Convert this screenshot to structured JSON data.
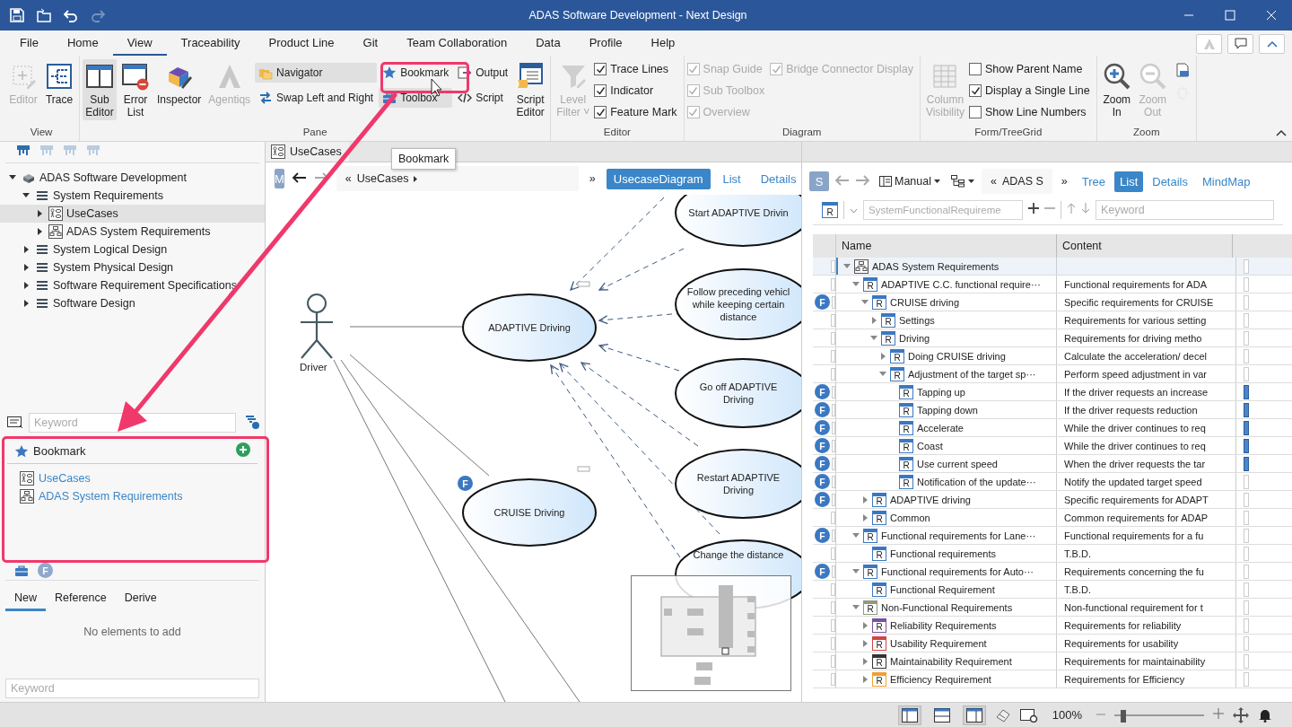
{
  "window": {
    "title": "ADAS Software Development - Next Design"
  },
  "quick_access": [
    {
      "disabled": false
    },
    {
      "disabled": false
    },
    {
      "disabled": false
    },
    {
      "disabled": true
    }
  ],
  "menu": [
    {
      "label": "File",
      "selected": false
    },
    {
      "label": "Home",
      "selected": false
    },
    {
      "label": "View",
      "selected": true
    },
    {
      "label": "Traceability",
      "selected": false
    },
    {
      "label": "Product Line",
      "selected": false
    },
    {
      "label": "Git",
      "selected": false
    },
    {
      "label": "Team Collaboration",
      "selected": false
    },
    {
      "label": "Data",
      "selected": false
    },
    {
      "label": "Profile",
      "selected": false
    },
    {
      "label": "Help",
      "selected": false
    }
  ],
  "ribbon": [
    {
      "label": "View",
      "columns": [
        [
          {
            "kind": "big",
            "label": "Editor",
            "disabled": true,
            "selected": false
          }
        ],
        [
          {
            "kind": "big",
            "label": "Trace",
            "disabled": false,
            "selected": false
          }
        ]
      ]
    },
    {
      "label": "Pane",
      "columns": [
        [
          {
            "kind": "big",
            "label": "Sub\nEditor",
            "disabled": false,
            "selected": true
          }
        ],
        [
          {
            "kind": "big",
            "label": "Error\nList",
            "disabled": false,
            "selected": false
          }
        ],
        [
          {
            "kind": "big",
            "label": "Inspector",
            "disabled": false,
            "selected": false
          }
        ],
        [
          {
            "kind": "big",
            "label": "Agentiqs",
            "disabled": true,
            "selected": false
          }
        ],
        [
          {
            "kind": "small",
            "label": "Navigator",
            "disabled": false,
            "selected": true
          },
          {
            "kind": "small",
            "label": "Swap Left and Right",
            "disabled": false,
            "selected": false
          }
        ],
        [
          {
            "kind": "small",
            "label": "Bookmark",
            "disabled": false,
            "selected": false
          },
          {
            "kind": "small",
            "label": "Toolbox",
            "disabled": false,
            "selected": true
          }
        ],
        [
          {
            "kind": "small",
            "label": "Output",
            "disabled": false,
            "selected": false
          },
          {
            "kind": "small",
            "label": "Script",
            "disabled": false,
            "selected": false
          }
        ],
        [
          {
            "kind": "big",
            "label": "Script\nEditor",
            "disabled": false,
            "selected": false
          }
        ]
      ]
    },
    {
      "label": "Editor",
      "columns": [
        [
          {
            "kind": "big",
            "label": "Level\nFilter ˅",
            "disabled": true,
            "selected": false
          }
        ],
        [
          {
            "kind": "check",
            "label": "Trace Lines",
            "checked": true,
            "disabled": false
          },
          {
            "kind": "check",
            "label": "Indicator",
            "checked": true,
            "disabled": false
          },
          {
            "kind": "check",
            "label": "Feature Mark",
            "checked": true,
            "disabled": false
          }
        ]
      ]
    },
    {
      "label": "Diagram",
      "columns": [
        [
          {
            "kind": "check",
            "label": "Snap Guide",
            "checked": true,
            "disabled": true
          },
          {
            "kind": "check",
            "label": "Sub Toolbox",
            "checked": true,
            "disabled": true
          },
          {
            "kind": "check",
            "label": "Overview",
            "checked": true,
            "disabled": true
          }
        ],
        [
          {
            "kind": "check",
            "label": "Bridge Connector Display",
            "checked": true,
            "disabled": true
          }
        ]
      ]
    },
    {
      "label": "Form/TreeGrid",
      "columns": [
        [
          {
            "kind": "big",
            "label": "Column\nVisibility",
            "disabled": true,
            "selected": false
          }
        ],
        [
          {
            "kind": "check",
            "label": "Show Parent Name",
            "checked": false,
            "disabled": false
          },
          {
            "kind": "check",
            "label": "Display a Single Line",
            "checked": true,
            "disabled": false
          },
          {
            "kind": "check",
            "label": "Show Line Numbers",
            "checked": false,
            "disabled": false
          }
        ]
      ]
    },
    {
      "label": "Zoom",
      "columns": [
        [
          {
            "kind": "big",
            "label": "Zoom\nIn",
            "disabled": false,
            "selected": false
          }
        ],
        [
          {
            "kind": "big",
            "label": "Zoom\nOut",
            "disabled": true,
            "selected": false
          }
        ],
        [
          {
            "kind": "icon",
            "disabled": false,
            "selected": false
          },
          {
            "kind": "icon",
            "disabled": true,
            "selected": false
          }
        ]
      ]
    }
  ],
  "tooltip": {
    "text": "Bookmark"
  },
  "model_panel": {
    "toolbar": [
      {
        "disabled": false
      },
      {
        "disabled": true
      },
      {
        "disabled": true
      },
      {
        "disabled": true
      }
    ],
    "tree": [
      {
        "kind": "project",
        "label": "ADAS Software Development",
        "expanded": true,
        "selected": false,
        "children": [
          {
            "kind": "folder",
            "label": "System Requirements",
            "expanded": true,
            "selected": false,
            "children": [
              {
                "kind": "usecase",
                "label": "UseCases",
                "expanded": false,
                "selected": true
              },
              {
                "kind": "package",
                "label": "ADAS System Requirements",
                "expanded": false,
                "selected": false
              }
            ]
          },
          {
            "kind": "folder",
            "label": "System Logical Design",
            "expanded": false,
            "selected": false
          },
          {
            "kind": "folder",
            "label": "System Physical Design",
            "expanded": false,
            "selected": false
          },
          {
            "kind": "folder",
            "label": "Software Requirement Specifications",
            "expanded": false,
            "selected": false
          },
          {
            "kind": "folder",
            "label": "Software Design",
            "expanded": false,
            "selected": false
          }
        ]
      }
    ],
    "search": {
      "placeholder": "Keyword"
    }
  },
  "bookmark_panel": {
    "title": "Bookmark",
    "items": [
      {
        "kind": "usecase",
        "label": "UseCases"
      },
      {
        "kind": "package",
        "label": "ADAS System Requirements"
      }
    ]
  },
  "toolbox_panel": {
    "badge": "F",
    "tabs": [
      {
        "label": "New",
        "selected": true
      },
      {
        "label": "Reference",
        "selected": false
      },
      {
        "label": "Derive",
        "selected": false
      }
    ],
    "empty_text": "No elements to add",
    "search": {
      "placeholder": "Keyword"
    }
  },
  "editor": {
    "tab": "UseCases",
    "badge": "M",
    "nav": [
      {
        "disabled": false
      },
      {
        "disabled": true
      }
    ],
    "breadcrumb_back": "«",
    "breadcrumb": "UseCases",
    "breadcrumb_more": "»",
    "views": [
      {
        "label": "UsecaseDiagram",
        "selected": true
      },
      {
        "label": "List",
        "selected": false
      },
      {
        "label": "Details",
        "selected": false
      }
    ],
    "diagram": {
      "actor": "Driver",
      "use_cases": [
        {
          "label": "ADAPTIVE Driving"
        },
        {
          "label": "CRUISE Driving",
          "mark": "F"
        },
        {
          "label": "Start ADAPTIVE Drivin"
        },
        {
          "label": "Follow preceding vehicl\nwhile keeping certain\ndistance"
        },
        {
          "label": "Go off ADAPTIVE\nDriving"
        },
        {
          "label": "Restart ADAPTIVE\nDriving"
        },
        {
          "label": "Change the distance"
        }
      ]
    }
  },
  "sub_editor": {
    "badge": "S",
    "nav": [
      {
        "disabled": true
      },
      {
        "disabled": true
      }
    ],
    "mode": "Manual",
    "breadcrumb_back": "«",
    "breadcrumb": "ADAS S",
    "breadcrumb_more": "»",
    "views": [
      {
        "label": "Tree",
        "selected": false
      },
      {
        "label": "List",
        "selected": true
      },
      {
        "label": "Details",
        "selected": false
      },
      {
        "label": "MindMap",
        "selected": false
      }
    ],
    "type_tag": "R",
    "type_field": {
      "value": "SystemFunctionalRequireme",
      "disabled": true
    },
    "search": {
      "placeholder": "Keyword"
    },
    "grid": {
      "columns": [
        "Name",
        "Content"
      ],
      "rows": [
        {
          "kind": "package",
          "name": "ADAS System Requirements",
          "selected": true,
          "flagged": false,
          "expanded": true,
          "children": [
            {
              "kind": "requirement",
              "tag": "R",
              "color": "#3a78c2",
              "name": "ADAPTIVE C.C. functional require···",
              "content": "Functional requirements for ADA",
              "selected": false,
              "flagged": false,
              "expanded": true,
              "children": [
                {
                  "kind": "requirement",
                  "tag": "R",
                  "color": "#3a78c2",
                  "mark": "F",
                  "name": "CRUISE driving",
                  "content": "Specific requirements for CRUISE",
                  "selected": false,
                  "flagged": false,
                  "expanded": true,
                  "children": [
                    {
                      "kind": "requirement",
                      "tag": "R",
                      "color": "#3a78c2",
                      "name": "Settings",
                      "content": "Requirements for various setting",
                      "selected": false,
                      "flagged": false,
                      "expanded": false
                    },
                    {
                      "kind": "requirement",
                      "tag": "R",
                      "color": "#3a78c2",
                      "name": "Driving",
                      "content": "Requirements for driving metho",
                      "selected": false,
                      "flagged": false,
                      "expanded": true,
                      "children": [
                        {
                          "kind": "requirement",
                          "tag": "R",
                          "color": "#3a78c2",
                          "name": "Doing CRUISE driving",
                          "content": "Calculate the acceleration/ decel",
                          "selected": false,
                          "flagged": false,
                          "expanded": false
                        },
                        {
                          "kind": "requirement",
                          "tag": "R",
                          "color": "#3a78c2",
                          "name": "Adjustment of the target sp···",
                          "content": "Perform speed adjustment in var",
                          "selected": false,
                          "flagged": false,
                          "expanded": true,
                          "children": [
                            {
                              "kind": "requirement",
                              "tag": "R",
                              "color": "#3a78c2",
                              "mark": "F",
                              "name": "Tapping up",
                              "content": "If the driver requests an increase",
                              "selected": false,
                              "flagged": true
                            },
                            {
                              "kind": "requirement",
                              "tag": "R",
                              "color": "#3a78c2",
                              "mark": "F",
                              "name": "Tapping down",
                              "content": "If the driver requests reduction",
                              "selected": false,
                              "flagged": true
                            },
                            {
                              "kind": "requirement",
                              "tag": "R",
                              "color": "#3a78c2",
                              "mark": "F",
                              "name": "Accelerate",
                              "content": "While the driver continues to req",
                              "selected": false,
                              "flagged": true
                            },
                            {
                              "kind": "requirement",
                              "tag": "R",
                              "color": "#3a78c2",
                              "mark": "F",
                              "name": "Coast",
                              "content": "While the driver continues to req",
                              "selected": false,
                              "flagged": true
                            },
                            {
                              "kind": "requirement",
                              "tag": "R",
                              "color": "#3a78c2",
                              "mark": "F",
                              "name": "Use current speed",
                              "content": "When the driver requests the tar",
                              "selected": false,
                              "flagged": true
                            },
                            {
                              "kind": "requirement",
                              "tag": "R",
                              "color": "#3a78c2",
                              "mark": "F",
                              "name": "Notification of the update···",
                              "content": "Notify the updated target speed",
                              "selected": false,
                              "flagged": false
                            }
                          ]
                        }
                      ]
                    }
                  ]
                },
                {
                  "kind": "requirement",
                  "tag": "R",
                  "color": "#3a78c2",
                  "mark": "F",
                  "name": "ADAPTIVE driving",
                  "content": "Specific requirements for ADAPT",
                  "selected": false,
                  "flagged": false,
                  "expanded": false
                },
                {
                  "kind": "requirement",
                  "tag": "R",
                  "color": "#3a78c2",
                  "name": "Common",
                  "content": "Common requirements for ADAP",
                  "selected": false,
                  "flagged": false,
                  "expanded": false
                }
              ]
            },
            {
              "kind": "requirement",
              "tag": "R",
              "color": "#3a78c2",
              "mark": "F",
              "name": "Functional requirements for Lane···",
              "content": "Functional requirements for a fu",
              "selected": false,
              "flagged": false,
              "expanded": true,
              "children": [
                {
                  "kind": "requirement",
                  "tag": "R",
                  "color": "#3a78c2",
                  "name": "Functional requirements",
                  "content": "T.B.D.",
                  "selected": false,
                  "flagged": false
                }
              ]
            },
            {
              "kind": "requirement",
              "tag": "R",
              "color": "#3a78c2",
              "mark": "F",
              "name": "Functional requirements for Auto···",
              "content": "Requirements concerning the fu",
              "selected": false,
              "flagged": false,
              "expanded": true,
              "children": [
                {
                  "kind": "requirement",
                  "tag": "R",
                  "color": "#3a78c2",
                  "name": "Functional Requirement",
                  "content": "T.B.D.",
                  "selected": false,
                  "flagged": false
                }
              ]
            },
            {
              "kind": "requirement",
              "tag": "R",
              "color": "#8f9a7e",
              "name": "Non-Functional Requirements",
              "content": "Non-functional requirement for t",
              "selected": false,
              "flagged": false,
              "expanded": true,
              "children": [
                {
                  "kind": "requirement",
                  "tag": "R",
                  "color": "#7b4fa0",
                  "name": "Reliability Requirements",
                  "content": "Requirements for reliability",
                  "selected": false,
                  "flagged": false,
                  "expanded": false
                },
                {
                  "kind": "requirement",
                  "tag": "R",
                  "color": "#d04545",
                  "name": "Usability Requirement",
                  "content": "Requirements for usability",
                  "selected": false,
                  "flagged": false,
                  "expanded": false
                },
                {
                  "kind": "requirement",
                  "tag": "R",
                  "color": "#333333",
                  "name": "Maintainability Requirement",
                  "content": "Requirements for maintainability",
                  "selected": false,
                  "flagged": false,
                  "expanded": false
                },
                {
                  "kind": "requirement",
                  "tag": "R",
                  "color": "#f0a030",
                  "name": "Efficiency Requirement",
                  "content": "Requirements for Efficiency",
                  "selected": false,
                  "flagged": false,
                  "expanded": false
                }
              ]
            }
          ]
        }
      ]
    }
  },
  "status_bar": {
    "layouts": [
      {
        "selected": true
      },
      {
        "selected": false
      },
      {
        "selected": true
      }
    ],
    "zoom": "100%",
    "zoom_slider": {
      "level": 0.1
    }
  }
}
